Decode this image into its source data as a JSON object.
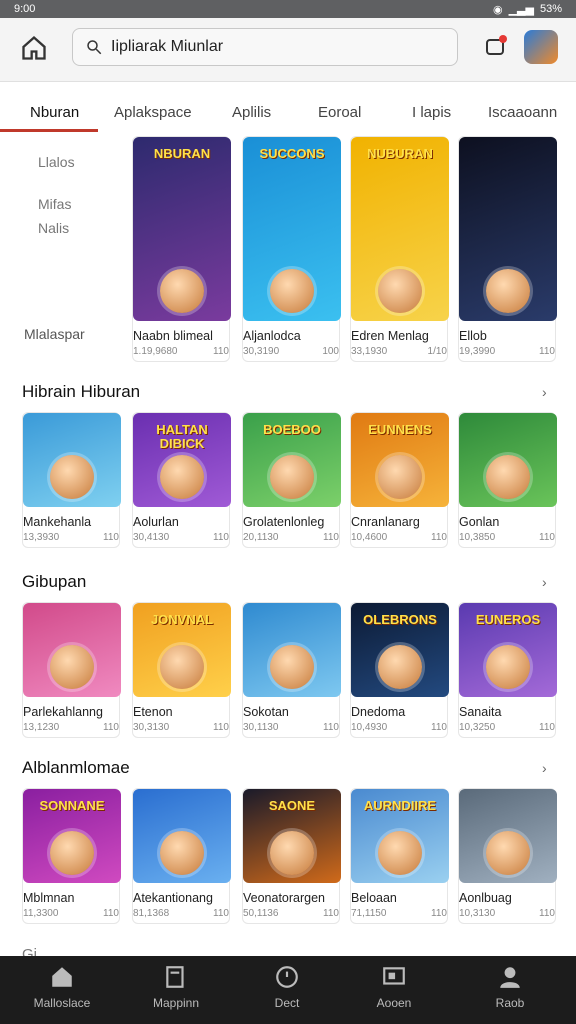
{
  "status": {
    "time": "9:00",
    "battery": "53%"
  },
  "search": {
    "query": "Iipliarak Miunlar"
  },
  "tabs": [
    "Nburan",
    "Aplakspace",
    "Aplilis",
    "Eoroal",
    "I lapis",
    "Iscaaoann"
  ],
  "sidebar": {
    "items": [
      "Llalos",
      "Mifas",
      "Nalis",
      "Mlalaspar"
    ]
  },
  "featured": [
    {
      "title": "Naabn blimeal",
      "meta1": "1.19,9680",
      "meta2": "110",
      "banner": "NBURAN",
      "c1": "#2d2a6e",
      "c2": "#7a3b9e"
    },
    {
      "title": "Aljanlodca",
      "meta1": "30,3190",
      "meta2": "100",
      "banner": "SUCCONS",
      "c1": "#1a8fd6",
      "c2": "#3bc0f0"
    },
    {
      "title": "Edren Menlag",
      "meta1": "33,1930",
      "meta2": "1/10",
      "banner": "NUBURAN",
      "c1": "#f1b200",
      "c2": "#f7d34a"
    },
    {
      "title": "Ellob",
      "meta1": "19,3990",
      "meta2": "110",
      "banner": "",
      "c1": "#0d1020",
      "c2": "#2a3b6a"
    }
  ],
  "sections": [
    {
      "title": "Hibrain Hiburan",
      "items": [
        {
          "title": "Mankehanla",
          "meta1": "13,3930",
          "meta2": "110",
          "banner": "",
          "c1": "#3a9ad8",
          "c2": "#7fd0f0"
        },
        {
          "title": "Aolurlan",
          "meta1": "30,4130",
          "meta2": "110",
          "banner": "HALTAN DIBICK",
          "c1": "#6a2fb0",
          "c2": "#a05ad6"
        },
        {
          "title": "Grolatenlonleg",
          "meta1": "20,1130",
          "meta2": "110",
          "banner": "BOEBOO",
          "c1": "#3aa04a",
          "c2": "#7cd06a"
        },
        {
          "title": "Cnranlanarg",
          "meta1": "10,4600",
          "meta2": "110",
          "banner": "EUNNENS",
          "c1": "#e07a12",
          "c2": "#f6b33a"
        },
        {
          "title": "Gonlan",
          "meta1": "10,3850",
          "meta2": "110",
          "banner": "",
          "c1": "#2e8a3a",
          "c2": "#6ac45a"
        }
      ]
    },
    {
      "title": "Gibupan",
      "items": [
        {
          "title": "Parlekahlanng",
          "meta1": "13,1230",
          "meta2": "110",
          "banner": "",
          "c1": "#d14a8a",
          "c2": "#f08ac0"
        },
        {
          "title": "Etenon",
          "meta1": "30,3130",
          "meta2": "110",
          "banner": "JONVNAL",
          "c1": "#f0a020",
          "c2": "#ffd04a"
        },
        {
          "title": "Sokotan",
          "meta1": "30,1130",
          "meta2": "110",
          "banner": "",
          "c1": "#2f8ad0",
          "c2": "#7ec8f0"
        },
        {
          "title": "Dnedoma",
          "meta1": "10,4930",
          "meta2": "110",
          "banner": "OLEBRONS",
          "c1": "#0c1a34",
          "c2": "#234a80"
        },
        {
          "title": "Sanaita",
          "meta1": "10,3250",
          "meta2": "110",
          "banner": "EUNEROS",
          "c1": "#5a3ab0",
          "c2": "#a46ad8"
        }
      ]
    },
    {
      "title": "Alblanmlomae",
      "items": [
        {
          "title": "Mblmnan",
          "meta1": "11,3300",
          "meta2": "110",
          "banner": "SONNANE",
          "c1": "#8a1fa0",
          "c2": "#d04ac0"
        },
        {
          "title": "Atekantionang",
          "meta1": "81,1368",
          "meta2": "110",
          "banner": "",
          "c1": "#2a6ed0",
          "c2": "#6ab0f0"
        },
        {
          "title": "Veonatorargen",
          "meta1": "50,1136",
          "meta2": "110",
          "banner": "SAONE",
          "c1": "#1a1a2a",
          "c2": "#d06a1a"
        },
        {
          "title": "Beloaan",
          "meta1": "71,1150",
          "meta2": "110",
          "banner": "AURNDIIRE",
          "c1": "#4a8ad0",
          "c2": "#9ad0f0"
        },
        {
          "title": "Aonlbuag",
          "meta1": "10,3130",
          "meta2": "110",
          "banner": "",
          "c1": "#5a6a7a",
          "c2": "#a0b0c0"
        }
      ]
    }
  ],
  "bottom_nav": [
    "Malloslace",
    "Mappinn",
    "Dect",
    "Aooen",
    "Raob"
  ],
  "colors": {
    "accent": "#c0392b",
    "nav_bg": "#1c1c1c",
    "topbar": "#f4f4f4"
  }
}
